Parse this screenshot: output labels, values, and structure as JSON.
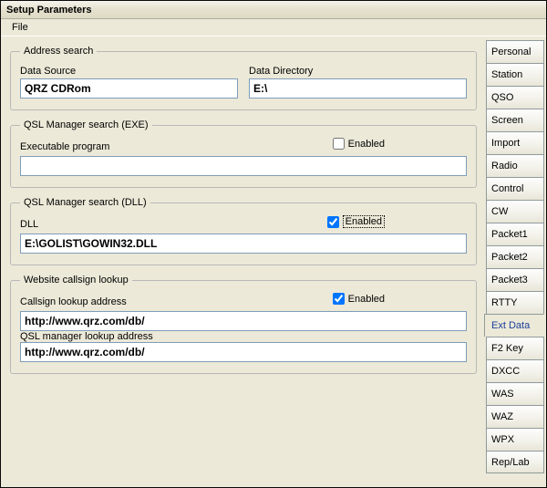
{
  "window": {
    "title": "Setup Parameters"
  },
  "menu": {
    "file": "File"
  },
  "groups": {
    "address": {
      "legend": "Address search",
      "dataSourceLabel": "Data Source",
      "dataSourceValue": "QRZ CDRom",
      "dataDirLabel": "Data Directory",
      "dataDirValue": "E:\\"
    },
    "qslExe": {
      "legend": "QSL Manager search (EXE)",
      "execLabel": "Executable program",
      "enabledLabel": "Enabled",
      "enabledChecked": false,
      "execValue": ""
    },
    "qslDll": {
      "legend": "QSL Manager search (DLL)",
      "dllLabel": "DLL",
      "enabledLabel": "Enabled",
      "enabledChecked": true,
      "dllValue": "E:\\GOLIST\\GOWIN32.DLL"
    },
    "website": {
      "legend": "Website callsign lookup",
      "callsignLabel": "Callsign lookup address",
      "callsignValue": "http://www.qrz.com/db/",
      "enabledLabel": "Enabled",
      "enabledChecked": true,
      "qslMgrLabel": "QSL manager lookup address",
      "qslMgrValue": "http://www.qrz.com/db/"
    }
  },
  "tabs": [
    {
      "label": "Personal",
      "active": false
    },
    {
      "label": "Station",
      "active": false
    },
    {
      "label": "QSO",
      "active": false
    },
    {
      "label": "Screen",
      "active": false
    },
    {
      "label": "Import",
      "active": false
    },
    {
      "label": "Radio",
      "active": false
    },
    {
      "label": "Control",
      "active": false
    },
    {
      "label": "CW",
      "active": false
    },
    {
      "label": "Packet1",
      "active": false
    },
    {
      "label": "Packet2",
      "active": false
    },
    {
      "label": "Packet3",
      "active": false
    },
    {
      "label": "RTTY",
      "active": false
    },
    {
      "label": "Ext Data",
      "active": true
    },
    {
      "label": "F2 Key",
      "active": false
    },
    {
      "label": "DXCC",
      "active": false
    },
    {
      "label": "WAS",
      "active": false
    },
    {
      "label": "WAZ",
      "active": false
    },
    {
      "label": "WPX",
      "active": false
    },
    {
      "label": "Rep/Lab",
      "active": false
    }
  ]
}
